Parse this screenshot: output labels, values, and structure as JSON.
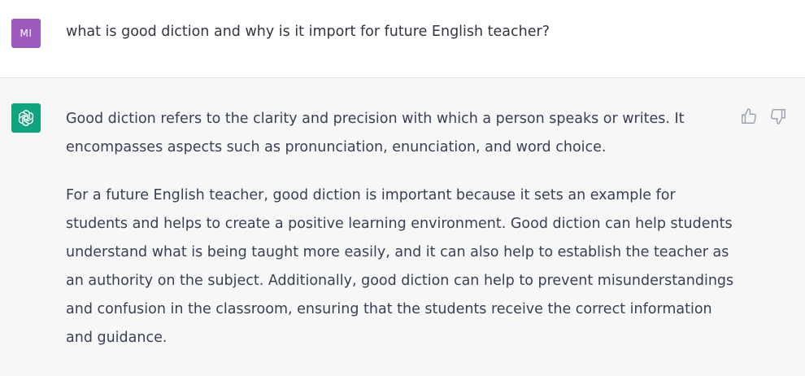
{
  "user_message": {
    "avatar_initials": "MI",
    "text": "what is good diction and why is it import for future English teacher?"
  },
  "assistant_message": {
    "paragraphs": [
      "Good diction refers to the clarity and precision with which a person speaks or writes. It encompasses aspects such as pronunciation, enunciation, and word choice.",
      "For a future English teacher, good diction is important because it sets an example for students and helps to create a positive learning environment. Good diction can help students understand what is being taught more easily, and it can also help to establish the teacher as an authority on the subject. Additionally, good diction can help to prevent misunderstandings and confusion in the classroom, ensuring that the students receive the correct information and guidance."
    ]
  },
  "icons": {
    "assistant_avatar": "openai-logo-icon",
    "like": "thumbs-up-icon",
    "dislike": "thumbs-down-icon"
  },
  "colors": {
    "user_avatar": "#9e5bbf",
    "assistant_avatar": "#10a37f",
    "assistant_background": "#f7f7f8"
  }
}
